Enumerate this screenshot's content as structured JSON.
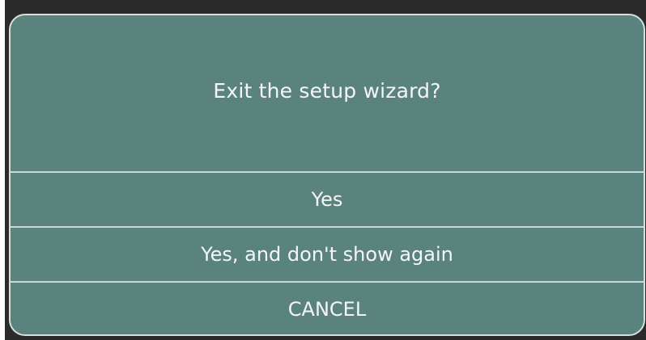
{
  "dialog": {
    "message": "Exit the setup wizard?",
    "options": [
      {
        "label": "Yes"
      },
      {
        "label": "Yes, and don't show again"
      },
      {
        "label": "CANCEL"
      }
    ]
  },
  "colors": {
    "dialog_background": "#5a837e",
    "divider": "#c9d8d5",
    "text": "#f4f7f6"
  }
}
